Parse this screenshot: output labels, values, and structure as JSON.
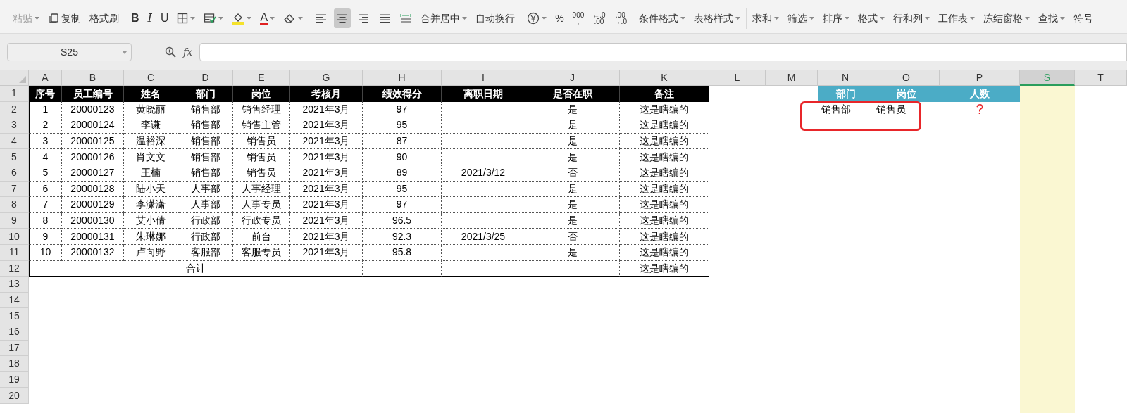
{
  "toolbar": {
    "groups": [
      {
        "items": [
          {
            "kind": "label",
            "label": "粘贴",
            "caret": true,
            "disabled": true
          },
          {
            "kind": "copy",
            "label": "复制",
            "caret": false,
            "disabled": false
          },
          {
            "kind": "label",
            "label": "格式刷",
            "caret": false,
            "disabled": false
          }
        ]
      },
      {
        "items": [
          {
            "kind": "bold",
            "label": "B",
            "caret": false,
            "disabled": false
          },
          {
            "kind": "italic",
            "label": "I",
            "caret": false,
            "disabled": false
          },
          {
            "kind": "underline",
            "label": "U",
            "caret": false,
            "disabled": false
          },
          {
            "kind": "borders",
            "caret": true,
            "disabled": false
          },
          {
            "kind": "format",
            "caret": true,
            "disabled": false
          },
          {
            "kind": "fill",
            "caret": true,
            "disabled": false
          },
          {
            "kind": "font-color",
            "label": "A",
            "caret": true,
            "disabled": false
          },
          {
            "kind": "eraser",
            "caret": true,
            "disabled": false
          }
        ]
      },
      {
        "items": [
          {
            "kind": "align-left",
            "selected": false
          },
          {
            "kind": "align-center",
            "selected": true
          },
          {
            "kind": "align-right",
            "selected": false
          },
          {
            "kind": "justify",
            "selected": false
          },
          {
            "kind": "distribute",
            "selected": false
          },
          {
            "kind": "label",
            "label": "合并居中",
            "caret": true,
            "disabled": false
          },
          {
            "kind": "label",
            "label": "自动换行",
            "caret": false,
            "disabled": false
          }
        ]
      },
      {
        "items": [
          {
            "kind": "currency",
            "caret": true,
            "disabled": false
          },
          {
            "kind": "label",
            "label": "%",
            "caret": false,
            "disabled": false
          },
          {
            "kind": "stack",
            "lines": [
              "000",
              ","
            ],
            "caret": false,
            "disabled": false
          },
          {
            "kind": "stack",
            "lines": [
              "←.0",
              ".00"
            ],
            "caret": false,
            "disabled": false
          },
          {
            "kind": "stack",
            "lines": [
              ".00",
              "→.0"
            ],
            "caret": false,
            "disabled": false
          }
        ]
      },
      {
        "items": [
          {
            "kind": "label",
            "label": "条件格式",
            "caret": true,
            "disabled": false
          },
          {
            "kind": "label",
            "label": "表格样式",
            "caret": true,
            "disabled": false
          }
        ]
      },
      {
        "items": [
          {
            "kind": "label",
            "label": "求和",
            "caret": true,
            "disabled": false
          },
          {
            "kind": "label",
            "label": "筛选",
            "caret": true,
            "disabled": false
          },
          {
            "kind": "label",
            "label": "排序",
            "caret": true,
            "disabled": false
          },
          {
            "kind": "label",
            "label": "格式",
            "caret": true,
            "disabled": false
          },
          {
            "kind": "label",
            "label": "行和列",
            "caret": true,
            "disabled": false
          },
          {
            "kind": "label",
            "label": "工作表",
            "caret": true,
            "disabled": false
          },
          {
            "kind": "label",
            "label": "冻结窗格",
            "caret": true,
            "disabled": false
          },
          {
            "kind": "label",
            "label": "查找",
            "caret": true,
            "disabled": false
          },
          {
            "kind": "label",
            "label": "符号",
            "caret": false,
            "disabled": false
          }
        ]
      }
    ]
  },
  "formula_bar": {
    "name_box": "S25",
    "fx": "fx"
  },
  "columns": [
    {
      "label": "A",
      "selected": false
    },
    {
      "label": "B",
      "selected": false
    },
    {
      "label": "C",
      "selected": false
    },
    {
      "label": "D",
      "selected": false
    },
    {
      "label": "E",
      "selected": false
    },
    {
      "label": "G",
      "selected": false
    },
    {
      "label": "H",
      "selected": false
    },
    {
      "label": "I",
      "selected": false
    },
    {
      "label": "J",
      "selected": false
    },
    {
      "label": "K",
      "selected": false
    },
    {
      "label": "L",
      "selected": false
    },
    {
      "label": "M",
      "selected": false
    },
    {
      "label": "N",
      "selected": false
    },
    {
      "label": "O",
      "selected": false
    },
    {
      "label": "P",
      "selected": false
    },
    {
      "label": "S",
      "selected": true
    },
    {
      "label": "T",
      "selected": false
    }
  ],
  "row_numbers": [
    "1",
    "2",
    "3",
    "4",
    "5",
    "6",
    "7",
    "8",
    "9",
    "10",
    "11",
    "12",
    "13",
    "14",
    "15",
    "16",
    "17",
    "18",
    "19",
    "20"
  ],
  "table": {
    "header": [
      "序号",
      "员工编号",
      "姓名",
      "部门",
      "岗位",
      "考核月",
      "绩效得分",
      "离职日期",
      "是否在职",
      "备注"
    ],
    "rows": [
      [
        "1",
        "20000123",
        "黄晓丽",
        "销售部",
        "销售经理",
        "2021年3月",
        "97",
        null,
        "是",
        "这是瞎编的"
      ],
      [
        "2",
        "20000124",
        "李谦",
        "销售部",
        "销售主管",
        "2021年3月",
        "95",
        null,
        "是",
        "这是瞎编的"
      ],
      [
        "3",
        "20000125",
        "温裕深",
        "销售部",
        "销售员",
        "2021年3月",
        "87",
        null,
        "是",
        "这是瞎编的"
      ],
      [
        "4",
        "20000126",
        "肖文文",
        "销售部",
        "销售员",
        "2021年3月",
        "90",
        null,
        "是",
        "这是瞎编的"
      ],
      [
        "5",
        "20000127",
        "王楠",
        "销售部",
        "销售员",
        "2021年3月",
        "89",
        "2021/3/12",
        "否",
        "这是瞎编的"
      ],
      [
        "6",
        "20000128",
        "陆小天",
        "人事部",
        "人事经理",
        "2021年3月",
        "95",
        null,
        "是",
        "这是瞎编的"
      ],
      [
        "7",
        "20000129",
        "李潇潇",
        "人事部",
        "人事专员",
        "2021年3月",
        "97",
        null,
        "是",
        "这是瞎编的"
      ],
      [
        "8",
        "20000130",
        "艾小倩",
        "行政部",
        "行政专员",
        "2021年3月",
        "96.5",
        null,
        "是",
        "这是瞎编的"
      ],
      [
        "9",
        "20000131",
        "朱琳娜",
        "行政部",
        "前台",
        "2021年3月",
        "92.3",
        "2021/3/25",
        "否",
        "这是瞎编的"
      ],
      [
        "10",
        "20000132",
        "卢向野",
        "客服部",
        "客服专员",
        "2021年3月",
        "95.8",
        null,
        "是",
        "这是瞎编的"
      ]
    ],
    "total": {
      "label": "合计",
      "note": "这是瞎编的"
    }
  },
  "lookup": {
    "header": [
      "部门",
      "岗位",
      "人数"
    ],
    "values": [
      "销售部",
      "销售员",
      "？"
    ]
  }
}
